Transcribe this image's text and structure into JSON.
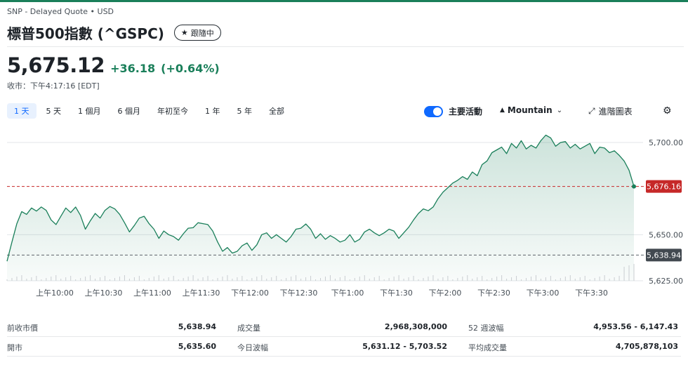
{
  "header": {
    "meta": "SNP - Delayed Quote • USD",
    "title": "標普500指數 (^GSPC)",
    "follow_label": "跟隨中"
  },
  "quote": {
    "price": "5,675.12",
    "change": "+36.18",
    "change_pct": "(+0.64%)",
    "close_time": "收市：下午4:17:16 [EDT]"
  },
  "range_tabs": [
    {
      "label": "1 天",
      "active": true
    },
    {
      "label": "5 天",
      "active": false
    },
    {
      "label": "1 個月",
      "active": false
    },
    {
      "label": "6 個月",
      "active": false
    },
    {
      "label": "年初至今",
      "active": false
    },
    {
      "label": "1 年",
      "active": false
    },
    {
      "label": "5 年",
      "active": false
    },
    {
      "label": "全部",
      "active": false
    }
  ],
  "controls": {
    "key_events_label": "主要活動",
    "key_events_on": true,
    "chart_type_label": "Mountain",
    "advanced_label": "進階圖表"
  },
  "colors": {
    "line": "#1a7f5a",
    "current_badge": "#c62828",
    "prev_close_badge": "#424950",
    "accent": "#0f69ff"
  },
  "chart_data": {
    "type": "area",
    "ylim": [
      5625,
      5708
    ],
    "y_ticks": [
      {
        "value": 5700,
        "label": "5,700.00"
      },
      {
        "value": 5650,
        "label": "5,650.00"
      },
      {
        "value": 5625,
        "label": "5,625.00"
      }
    ],
    "x_ticks": [
      "上午10:00",
      "上午10:30",
      "上午11:00",
      "上午11:30",
      "下午12:00",
      "下午12:30",
      "下午1:00",
      "下午1:30",
      "下午2:00",
      "下午2:30",
      "下午3:00",
      "下午3:30"
    ],
    "current_value": 5676.16,
    "current_label": "5,676.16",
    "prev_close_value": 5638.94,
    "prev_close_label": "5,638.94",
    "series": [
      {
        "values": [
          5635.6,
          5646.0,
          5656.0,
          5662.5,
          5661.0,
          5664.5,
          5662.8,
          5665.0,
          5663.2,
          5658.0,
          5655.5,
          5660.0,
          5664.5,
          5662.0,
          5665.0,
          5660.5,
          5653.0,
          5657.5,
          5661.5,
          5659.0,
          5663.2,
          5665.3,
          5664.0,
          5661.0,
          5656.5,
          5651.5,
          5655.0,
          5659.0,
          5660.0,
          5656.0,
          5653.0,
          5648.0,
          5652.0,
          5650.0,
          5649.0,
          5647.0,
          5650.5,
          5653.5,
          5653.8,
          5656.5,
          5656.0,
          5655.5,
          5652.0,
          5646.0,
          5641.0,
          5643.0,
          5640.0,
          5641.0,
          5644.0,
          5645.5,
          5641.5,
          5644.5,
          5650.0,
          5651.0,
          5648.0,
          5650.0,
          5648.0,
          5646.0,
          5649.0,
          5653.0,
          5653.5,
          5655.8,
          5653.0,
          5648.0,
          5650.5,
          5647.5,
          5649.5,
          5648.0,
          5646.0,
          5647.0,
          5650.0,
          5646.0,
          5647.5,
          5651.5,
          5653.0,
          5651.0,
          5649.5,
          5651.0,
          5653.0,
          5652.0,
          5648.0,
          5651.0,
          5654.0,
          5658.0,
          5661.5,
          5664.0,
          5663.0,
          5665.0,
          5669.5,
          5673.0,
          5675.5,
          5678.0,
          5679.5,
          5681.5,
          5680.0,
          5684.0,
          5682.0,
          5688.0,
          5690.0,
          5694.5,
          5696.0,
          5697.5,
          5694.0,
          5699.5,
          5697.0,
          5701.0,
          5696.5,
          5698.5,
          5697.0,
          5701.0,
          5704.0,
          5702.5,
          5698.0,
          5700.0,
          5700.5,
          5697.0,
          5699.0,
          5696.5,
          5698.0,
          5699.5,
          5694.0,
          5697.5,
          5697.0,
          5694.5,
          5695.5,
          5693.0,
          5690.0,
          5685.0,
          5676.16
        ]
      }
    ]
  },
  "stats": {
    "prev_close_label": "前收市價",
    "prev_close_value": "5,638.94",
    "open_label": "開市",
    "open_value": "5,635.60",
    "volume_label": "成交量",
    "volume_value": "2,968,308,000",
    "day_range_label": "今日波幅",
    "day_range_value": "5,631.12 - 5,703.52",
    "week52_label": "52 週波幅",
    "week52_value": "4,953.56 - 6,147.43",
    "avg_volume_label": "平均成交量",
    "avg_volume_value": "4,705,878,103"
  }
}
